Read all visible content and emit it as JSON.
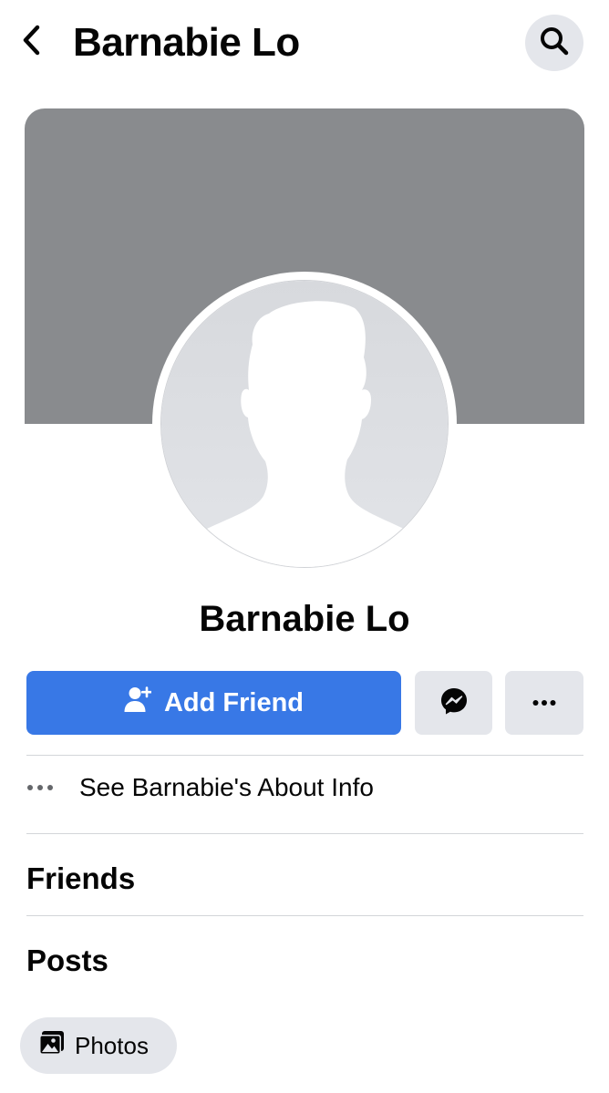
{
  "header": {
    "title": "Barnabie Lo",
    "back_icon": "chevron-left-icon",
    "search_icon": "search-icon"
  },
  "profile": {
    "name": "Barnabie Lo",
    "cover_color": "#898b8e"
  },
  "actions": {
    "add_friend_label": "Add Friend",
    "add_friend_icon": "add-friend-icon",
    "messenger_icon": "messenger-icon",
    "more_icon": "more-icon",
    "accent": "#3878e6"
  },
  "about": {
    "label": "See Barnabie's About Info",
    "icon": "ellipsis-icon"
  },
  "sections": {
    "friends": "Friends",
    "posts": "Posts"
  },
  "chips": {
    "photos_label": "Photos",
    "photos_icon": "photos-icon"
  }
}
